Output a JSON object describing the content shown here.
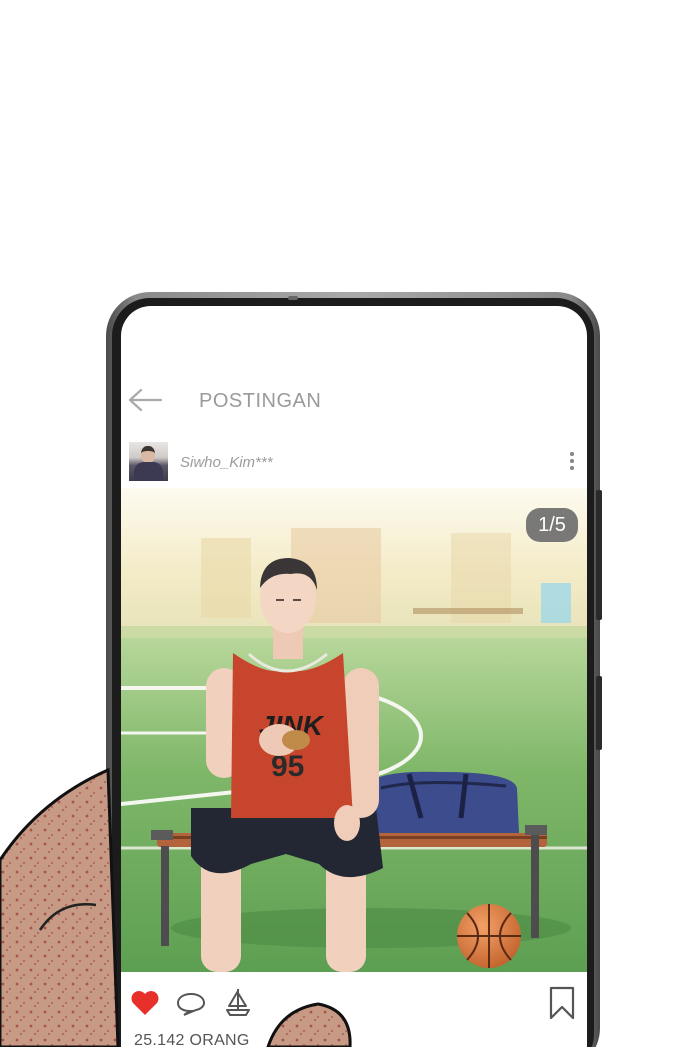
{
  "header": {
    "title": "POSTINGAN"
  },
  "post": {
    "username": "Siwho_Kim***",
    "image_counter": "1/5",
    "likes_text": "25.142 ORANG"
  },
  "icons": {
    "back": "arrow-left-icon",
    "more": "vertical-dots-icon",
    "like": "heart-icon",
    "comment": "comment-bubble-icon",
    "share": "sailboat-icon",
    "save": "bookmark-icon"
  },
  "colors": {
    "like": "#e8302a",
    "title": "#9a9a9a"
  }
}
